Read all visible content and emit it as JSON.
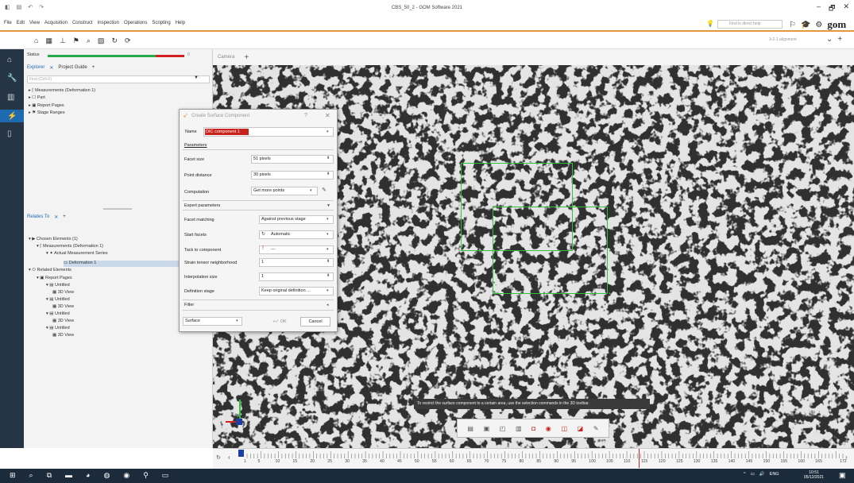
{
  "window": {
    "title": "CBS_50_2 - GOM Software 2021",
    "controls": [
      "–",
      "🗗",
      "✕"
    ]
  },
  "menu": [
    "File",
    "Edit",
    "View",
    "Acquisition",
    "Construct",
    "Inspection",
    "Operations",
    "Scripting",
    "Help"
  ],
  "help_search": {
    "placeholder": "Find in direct help"
  },
  "brand": "gom",
  "toolbar": {
    "alignment": "3-2-1 alignment"
  },
  "status": {
    "label": "Status",
    "num": "0"
  },
  "explorer": {
    "tabs": [
      "Explorer",
      "Project Guide"
    ],
    "find_placeholder": "Find (Ctrl+F)",
    "items": [
      "Measurements (Deformation 1)",
      "Part",
      "Report Pages",
      "Stage Ranges"
    ]
  },
  "related": {
    "tab": "Relates To",
    "items": [
      "Chosen Elements (1)",
      "Measurements (Deformation 1)",
      "Actual Measurement Series",
      "Deformation 1",
      "Related Elements",
      "Report Pages",
      "Untitled",
      "3D View",
      "Untitled",
      "3D View",
      "Untitled",
      "3D View",
      "Untitled",
      "3D View"
    ]
  },
  "viewport": {
    "tab": "Camera"
  },
  "dialog": {
    "title": "Create Surface Component",
    "help": "?",
    "name_label": "Name",
    "name_value": "DIC component 1",
    "parameters_label": "Parameters",
    "facet_size_label": "Facet size",
    "facet_size_value": "51 pixels",
    "point_distance_label": "Point distance",
    "point_distance_value": "30 pixels",
    "computation_label": "Computation",
    "computation_value": "Get more points",
    "expert_label": "Expert parameters",
    "facet_matching_label": "Facet matching",
    "facet_matching_value": "Against previous stage",
    "start_facets_label": "Start facets",
    "start_facets_value": "Automatic",
    "tack_label": "Tack to component",
    "tack_value": "---",
    "strain_label": "Strain tensor neighborhood",
    "strain_value": "1",
    "interp_label": "Interpolation size",
    "interp_value": "1",
    "def_stage_label": "Definition stage",
    "def_stage_value": "Keep original definition ...",
    "filter_label": "Filter",
    "surface_value": "Surface",
    "ok_label": "OK",
    "cancel_label": "Cancel"
  },
  "hint": "To restrict the surface component to a certain area, use the selection commands in the 3D toolbar.",
  "timeline": {
    "ticks": [
      "1",
      "5",
      "10",
      "15",
      "20",
      "25",
      "30",
      "35",
      "40",
      "45",
      "50",
      "55",
      "60",
      "65",
      "70",
      "75",
      "80",
      "85",
      "90",
      "95",
      "100",
      "105",
      "110",
      "115",
      "120",
      "125",
      "130",
      "135",
      "140",
      "145",
      "150",
      "155",
      "160",
      "165",
      "172"
    ]
  },
  "taskbar": {
    "lang": "ENG",
    "time": "10:51",
    "date": "05/12/2021"
  }
}
